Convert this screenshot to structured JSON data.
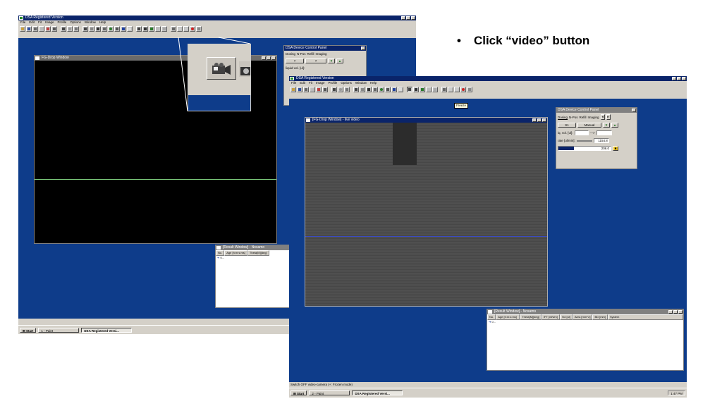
{
  "bullet": {
    "marker": "•",
    "text": "Click “video” button"
  },
  "back_app": {
    "title": "DSA Registered Version",
    "menu": [
      "File",
      "Edit",
      "Fit",
      "Image",
      "Profile",
      "Options",
      "Window",
      "Help"
    ],
    "drop_window_title": "FG-Drop Window",
    "result_window": {
      "title": "[Result Window] - Nosamo",
      "columns": [
        "No.",
        "Age [h:m:s:ms]",
        "Theta[M][deg]"
      ],
      "row_value": "0..."
    },
    "status_right": "[570,350]",
    "taskbar": {
      "start": "Start",
      "items": [
        "1 - Paint",
        "DSA Registered Versi..."
      ]
    },
    "control_panel": {
      "title": "DSA Device Control Panel",
      "tabs": [
        "Dosing",
        "N-Pos",
        "Refill",
        "Imaging"
      ],
      "sel1": "?",
      "sel2": "?",
      "lq_label": "liquid vol. [ul]:"
    }
  },
  "front_app": {
    "title": "DSA Registered Version",
    "menu": [
      "File",
      "Edit",
      "Fit",
      "Image",
      "Profile",
      "Options",
      "Window",
      "Help"
    ],
    "tooltip": "Freeze",
    "drop_window_title": "[FG-Drop Window] - live video",
    "control_panel": {
      "title": "DSA Device Control Panel",
      "tabs": [
        "Dosing",
        "N-Pos",
        "Refill",
        "Imaging"
      ],
      "syringe": "S1",
      "mode": "Manual",
      "lq_label": "lq. vol. [ul]:",
      "arrow": "--->",
      "rate_label": "rate [ul/min]:",
      "rate_value": "1154.8",
      "progress_value": "206.0",
      "progress_fraction": 0.3
    },
    "result_window": {
      "title": "[Result Window] - Nosamo",
      "columns": [
        "No.",
        "Age [h:m:s:ms]",
        "Theta[M][deg]",
        "IFT [mN/m]",
        "Vol [ul]",
        "Area [mm^2]",
        "BD [mm]",
        "System"
      ],
      "row_value": "0..."
    },
    "status_text": "Switch OFF video-camera (+: Frozen mode)",
    "taskbar": {
      "start": "Start",
      "items": [
        "2 - Paint",
        "DSA Registered Versi..."
      ],
      "clock": "1:47 PM"
    }
  },
  "colors": {
    "desktop": "#0e3c8a",
    "titlebar": "#0a246a",
    "baseline_back": "#7fd07f",
    "baseline_front": "#3b4cc0"
  }
}
